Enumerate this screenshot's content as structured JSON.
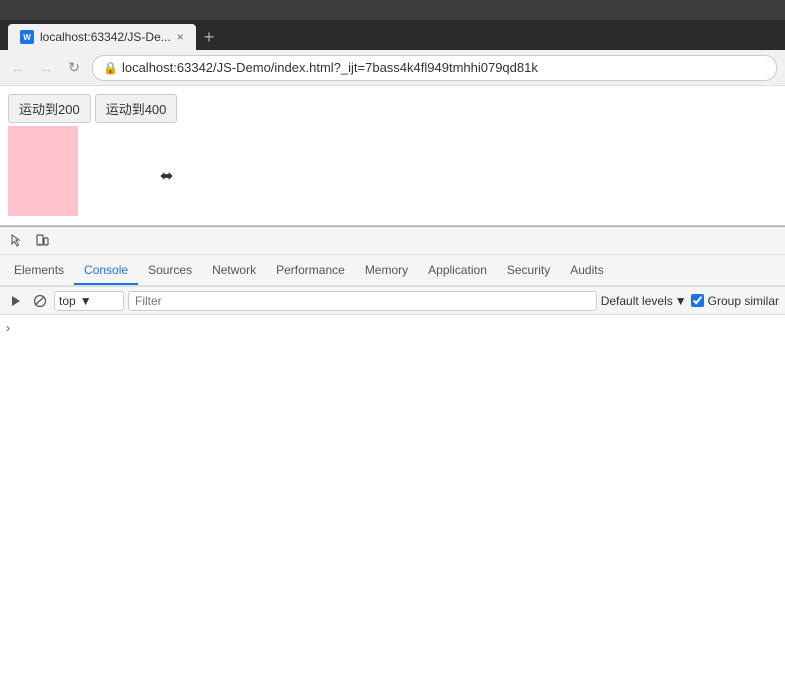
{
  "browser": {
    "tab_favicon": "W",
    "tab_title": "localhost:63342/JS-De...",
    "tab_close": "×",
    "tab_new": "+",
    "url": "localhost:63342/JS-Demo/index.html?_ijt=7bass4k4fl949tmhhi079qd81k"
  },
  "page": {
    "btn1_label": "运动到200",
    "btn2_label": "运动到400"
  },
  "devtools": {
    "tabs": [
      {
        "label": "Elements",
        "active": false
      },
      {
        "label": "Console",
        "active": true
      },
      {
        "label": "Sources",
        "active": false
      },
      {
        "label": "Network",
        "active": false
      },
      {
        "label": "Performance",
        "active": false
      },
      {
        "label": "Memory",
        "active": false
      },
      {
        "label": "Application",
        "active": false
      },
      {
        "label": "Security",
        "active": false
      },
      {
        "label": "Audits",
        "active": false
      }
    ],
    "console": {
      "context": "top",
      "filter_placeholder": "Filter",
      "default_levels": "Default levels",
      "group_similar": "Group similar"
    }
  }
}
